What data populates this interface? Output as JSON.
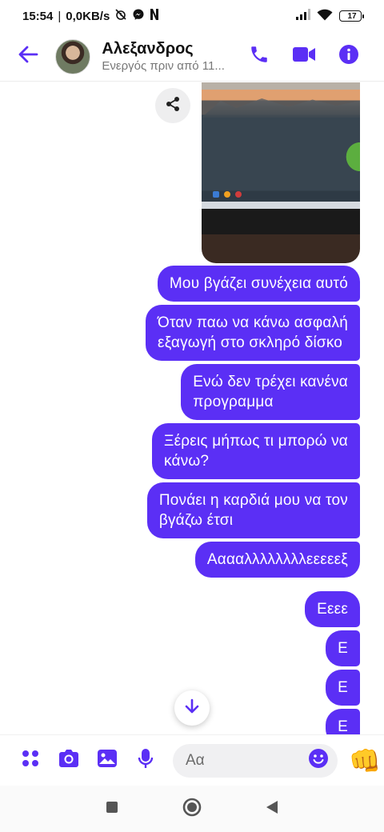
{
  "status_bar": {
    "time": "15:54",
    "network_speed": "0,0KB/s",
    "battery_level": "17",
    "battery_fraction": 0.17,
    "icons": [
      "alarm-off-icon",
      "messenger-notification-icon",
      "netflix-notification-icon",
      "signal-icon",
      "wifi-icon",
      "battery-icon"
    ]
  },
  "header": {
    "contact_name": "Αλεξανδρος",
    "contact_status": "Ενεργός πριν από 11...",
    "accent_color": "#5b2ff5",
    "icons": [
      "back-arrow-icon",
      "phone-icon",
      "video-camera-icon",
      "info-icon"
    ]
  },
  "chat": {
    "bubble_color": "#5b2ff5",
    "messages": [
      {
        "text": "Μου βγάζει συνέχεια αυτό"
      },
      {
        "text": "Όταν παω να κάνω ασφαλή\nεξαγωγή στο σκληρό δίσκο"
      },
      {
        "text": "Ενώ δεν τρέχει κανένα\nπρογραμμα"
      },
      {
        "text": "Ξέρεις μήπως τι μπορώ να\nκάνω?"
      },
      {
        "text": "Πονάει η καρδιά μου να τον\nβγάζω έτσι"
      },
      {
        "text": "Ααααλλλλλλλλεεεεεξ"
      },
      {
        "text": "Εεεε"
      },
      {
        "text": "Ε"
      },
      {
        "text": "Ε"
      },
      {
        "text": "Ε"
      }
    ],
    "icons": [
      "share-icon",
      "scroll-down-arrow-icon"
    ]
  },
  "composer": {
    "placeholder": "Αα",
    "icons": [
      "apps-grid-icon",
      "camera-icon",
      "gallery-icon",
      "microphone-icon",
      "emoji-icon",
      "fist-bump-icon"
    ],
    "like_emoji": "👊"
  },
  "nav_bar": {
    "icons": [
      "recents-square-icon",
      "home-circle-icon",
      "back-triangle-icon"
    ]
  }
}
